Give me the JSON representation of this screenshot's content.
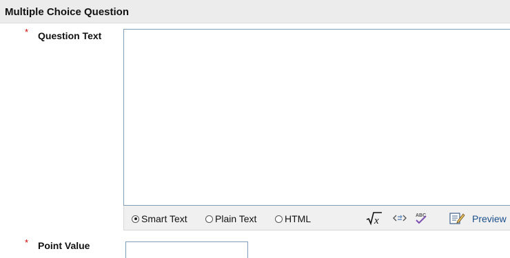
{
  "section": {
    "title": "Multiple Choice Question"
  },
  "required_marker": "*",
  "question_text": {
    "label": "Question Text",
    "value": ""
  },
  "format_options": [
    {
      "label": "Smart Text",
      "selected": true
    },
    {
      "label": "Plain Text",
      "selected": false
    },
    {
      "label": "HTML",
      "selected": false
    }
  ],
  "toolbar": {
    "icons": [
      "math-formula-icon",
      "insert-link-icon",
      "spell-check-icon",
      "preview-icon"
    ],
    "preview_label": "Preview"
  },
  "point_value": {
    "label": "Point Value",
    "value": ""
  },
  "colors": {
    "header_bg": "#ececec",
    "required": "#cc0000",
    "link": "#1a4e8a",
    "input_border": "#7f9db9"
  }
}
